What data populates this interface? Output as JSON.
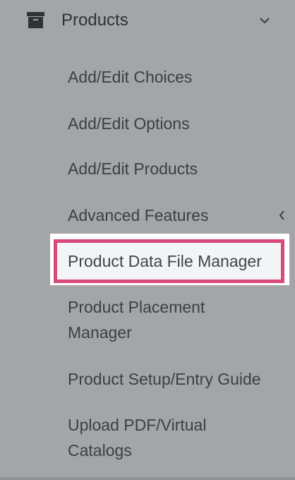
{
  "section": {
    "title": "Products",
    "icon": "archive-box-icon",
    "expand_icon": "chevron-down-icon"
  },
  "menu": {
    "items": [
      {
        "label": "Add/Edit Choices"
      },
      {
        "label": "Add/Edit Options"
      },
      {
        "label": "Add/Edit Products"
      },
      {
        "label": "Advanced Features",
        "submenu_icon": "chevron-left-icon"
      },
      {
        "label": "Product Data File Manager",
        "highlighted": true
      },
      {
        "label_line1": "Product Placement",
        "label_line2": "Manager"
      },
      {
        "label": "Product Setup/Entry Guide"
      },
      {
        "label_line1": "Upload PDF/Virtual",
        "label_line2": "Catalogs"
      }
    ]
  },
  "colors": {
    "sidebar_bg": "#a3a5a8",
    "text": "#3c3f45",
    "highlight_border": "#d7497a",
    "highlight_bg": "#ffffff"
  }
}
